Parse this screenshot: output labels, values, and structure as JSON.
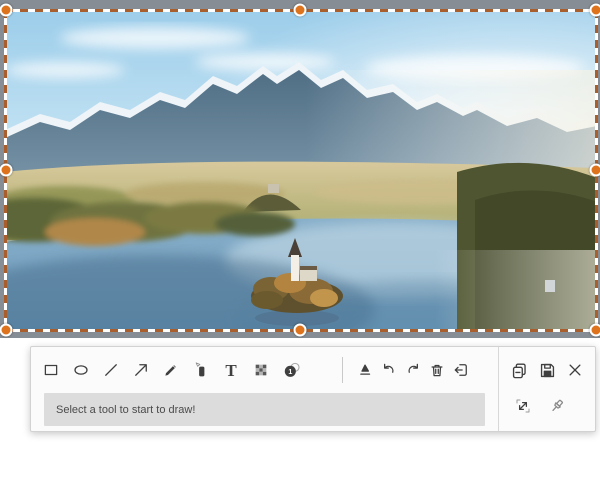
{
  "message_bar": {
    "text": "Select a tool to start to draw!"
  },
  "toolbar": {
    "text_tool_glyph": "T",
    "counter_glyph": "1",
    "tools": [
      "rectangle",
      "ellipse",
      "line",
      "arrow",
      "pencil",
      "marker",
      "text",
      "mosaic",
      "counter-step"
    ],
    "actions": [
      "eraser",
      "undo",
      "redo",
      "trash",
      "exit"
    ],
    "window_actions": [
      "copy",
      "save",
      "close",
      "expand",
      "pin"
    ]
  },
  "selection": {
    "handle_color": "#dd731c",
    "dash_color": "#a95f2d",
    "overlay_color": "#868d94"
  },
  "photo": {
    "subject": "snow-capped mountains, autumn valley and lake with small island church",
    "sky_color": "#a9d6ef",
    "water_color": "#7ba6c4"
  }
}
